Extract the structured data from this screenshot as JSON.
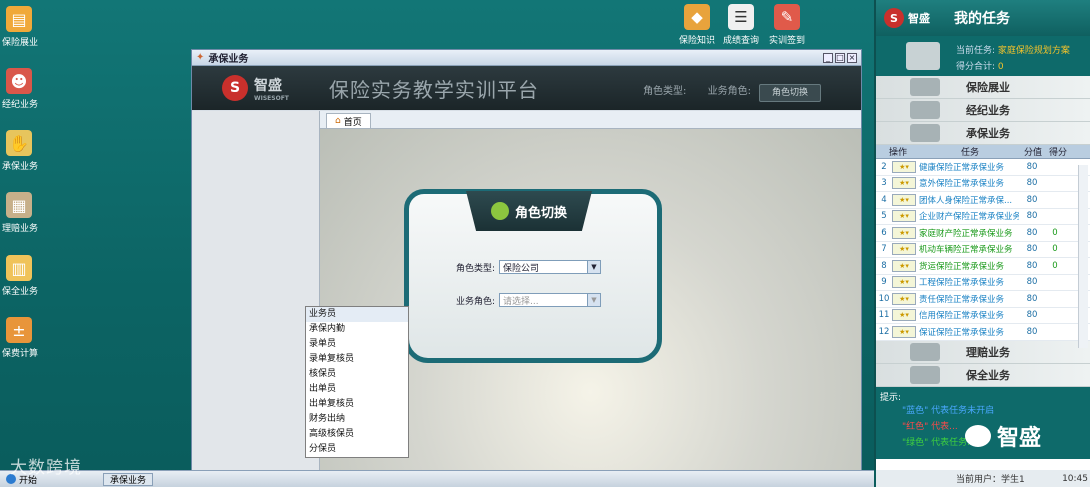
{
  "desktop_icons": [
    {
      "label": "保险展业",
      "icon": "folder-icon",
      "color": "#f0a93a"
    },
    {
      "label": "经纪业务",
      "icon": "person-icon",
      "color": "#d9574a"
    },
    {
      "label": "承保业务",
      "icon": "handshake-icon",
      "color": "#e7c55d"
    },
    {
      "label": "理赔业务",
      "icon": "document-icon",
      "color": "#c7b08a"
    },
    {
      "label": "保全业务",
      "icon": "calendar-icon",
      "color": "#f0c35a"
    },
    {
      "label": "保费计算",
      "icon": "calculator-icon",
      "color": "#e8953a"
    }
  ],
  "top_icons": [
    {
      "label": "保险知识",
      "icon": "book-icon",
      "color": "#e8a33c"
    },
    {
      "label": "成绩查询",
      "icon": "report-icon",
      "color": "#f0f0f0"
    },
    {
      "label": "实训签到",
      "icon": "signin-icon",
      "color": "#e05a4a"
    }
  ],
  "window": {
    "title": "承保业务",
    "brand": "智盛",
    "brand_sub": "WISESOFT",
    "platform_title": "保险实务教学实训平台",
    "role_type_label": "角色类型:",
    "business_role_label": "业务角色:",
    "switch_button": "角色切换",
    "tab_home": "首页"
  },
  "dialog": {
    "title": "角色切换",
    "role_type_label": "角色类型:",
    "role_type_value": "保险公司",
    "business_role_label": "业务角色:",
    "business_role_placeholder": "请选择..."
  },
  "dropdown_options": [
    "业务员",
    "承保内勤",
    "录单员",
    "录单复核员",
    "核保员",
    "出单员",
    "出单复核员",
    "财务出纳",
    "高级核保员",
    "分保员"
  ],
  "task_panel": {
    "brand": "智盛",
    "title": "我的任务",
    "current_task_label": "当前任务:",
    "current_task_value": "家庭保险规划方案",
    "score_label": "得分合计:",
    "score_value": "0",
    "categories_top": [
      "保险展业",
      "经纪业务",
      "承保业务"
    ],
    "categories_bottom": [
      "理赔业务",
      "保全业务"
    ],
    "table_headers": [
      "操作",
      "任务",
      "分值",
      "得分"
    ],
    "rows": [
      {
        "n": "2",
        "task": "健康保险正常承保业务",
        "score": "80",
        "got": "",
        "color": "blue"
      },
      {
        "n": "3",
        "task": "意外保险正常承保业务",
        "score": "80",
        "got": "",
        "color": "blue"
      },
      {
        "n": "4",
        "task": "团体人身保险正常承保...",
        "score": "80",
        "got": "",
        "color": "blue"
      },
      {
        "n": "5",
        "task": "企业财产保险正常承保业务",
        "score": "80",
        "got": "",
        "color": "blue"
      },
      {
        "n": "6",
        "task": "家庭财产险正常承保业务",
        "score": "80",
        "got": "0",
        "color": "green"
      },
      {
        "n": "7",
        "task": "机动车辆险正常承保业务",
        "score": "80",
        "got": "0",
        "color": "green"
      },
      {
        "n": "8",
        "task": "货运保险正常承保业务",
        "score": "80",
        "got": "0",
        "color": "green"
      },
      {
        "n": "9",
        "task": "工程保险正常承保业务",
        "score": "80",
        "got": "",
        "color": "blue"
      },
      {
        "n": "10",
        "task": "责任保险正常承保业务",
        "score": "80",
        "got": "",
        "color": "blue"
      },
      {
        "n": "11",
        "task": "信用保险正常承保业务",
        "score": "80",
        "got": "",
        "color": "blue"
      },
      {
        "n": "12",
        "task": "保证保险正常承保业务",
        "score": "80",
        "got": "",
        "color": "blue"
      }
    ],
    "tips_label": "提示:",
    "tip1": "\"蓝色\" 代表任务未开启",
    "tip2": "\"红色\" 代表...",
    "tip3": "\"绿色\" 代表任务...",
    "current_user": "当前用户：学生1",
    "time": "10:45"
  },
  "taskbar": {
    "start": "开始",
    "item": "承保业务"
  },
  "watermarks": {
    "left": "大数跨境",
    "right": "智盛"
  }
}
